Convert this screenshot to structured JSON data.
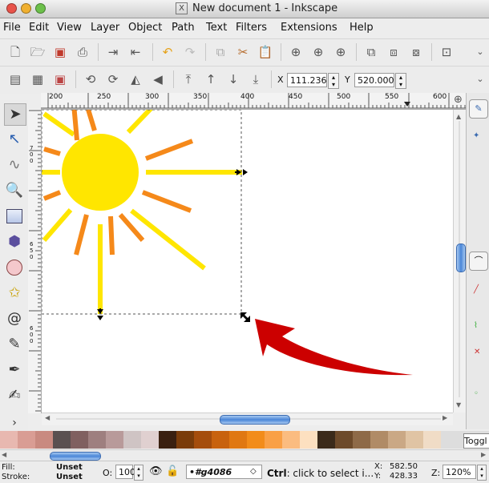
{
  "window": {
    "title": "New document 1 - Inkscape",
    "title_icon": "X"
  },
  "menu": [
    "File",
    "Edit",
    "View",
    "Layer",
    "Object",
    "Path",
    "Text",
    "Filters",
    "Extensions",
    "Help"
  ],
  "coords": {
    "x_label": "X",
    "x_value": "111.236",
    "y_label": "Y",
    "y_value": "520.000"
  },
  "ruler": {
    "ticks": [
      "200",
      "250",
      "300",
      "350",
      "400",
      "450",
      "500",
      "550",
      "600"
    ]
  },
  "palette_label": "Toggl",
  "colors": {
    "sun": "#ffe600",
    "rays_yellow": "#ffe600",
    "rays_orange": "#f5891a",
    "arrow": "#cc0000"
  },
  "swatches": [
    "#e8b8b0",
    "#d99d94",
    "#c98a80",
    "#5a5050",
    "#806060",
    "#9e7f7f",
    "#b89a9a",
    "#cfc4c4",
    "#e0d0d0",
    "#3a2010",
    "#7a3c0a",
    "#a54d0c",
    "#c8620e",
    "#e07812",
    "#f28c1a",
    "#f9a046",
    "#fbbc80",
    "#fde0c0",
    "#3b2a1a",
    "#6d4a2a",
    "#8e6a48",
    "#b08b66",
    "#caa885",
    "#e0c4a4",
    "#f0dcc6"
  ],
  "status": {
    "fill_label": "Fill:",
    "fill_value": "Unset",
    "stroke_label": "Stroke:",
    "stroke_value": "Unset",
    "opacity_label": "O:",
    "opacity_value": "100",
    "layer_value": "•#g4086",
    "message_bold": "Ctrl",
    "message_rest": ": click to select i...",
    "cursor_x_label": "X:",
    "cursor_x": "582.50",
    "cursor_y_label": "Y:",
    "cursor_y": "428.33",
    "zoom_label": "Z:",
    "zoom_value": "120%"
  }
}
